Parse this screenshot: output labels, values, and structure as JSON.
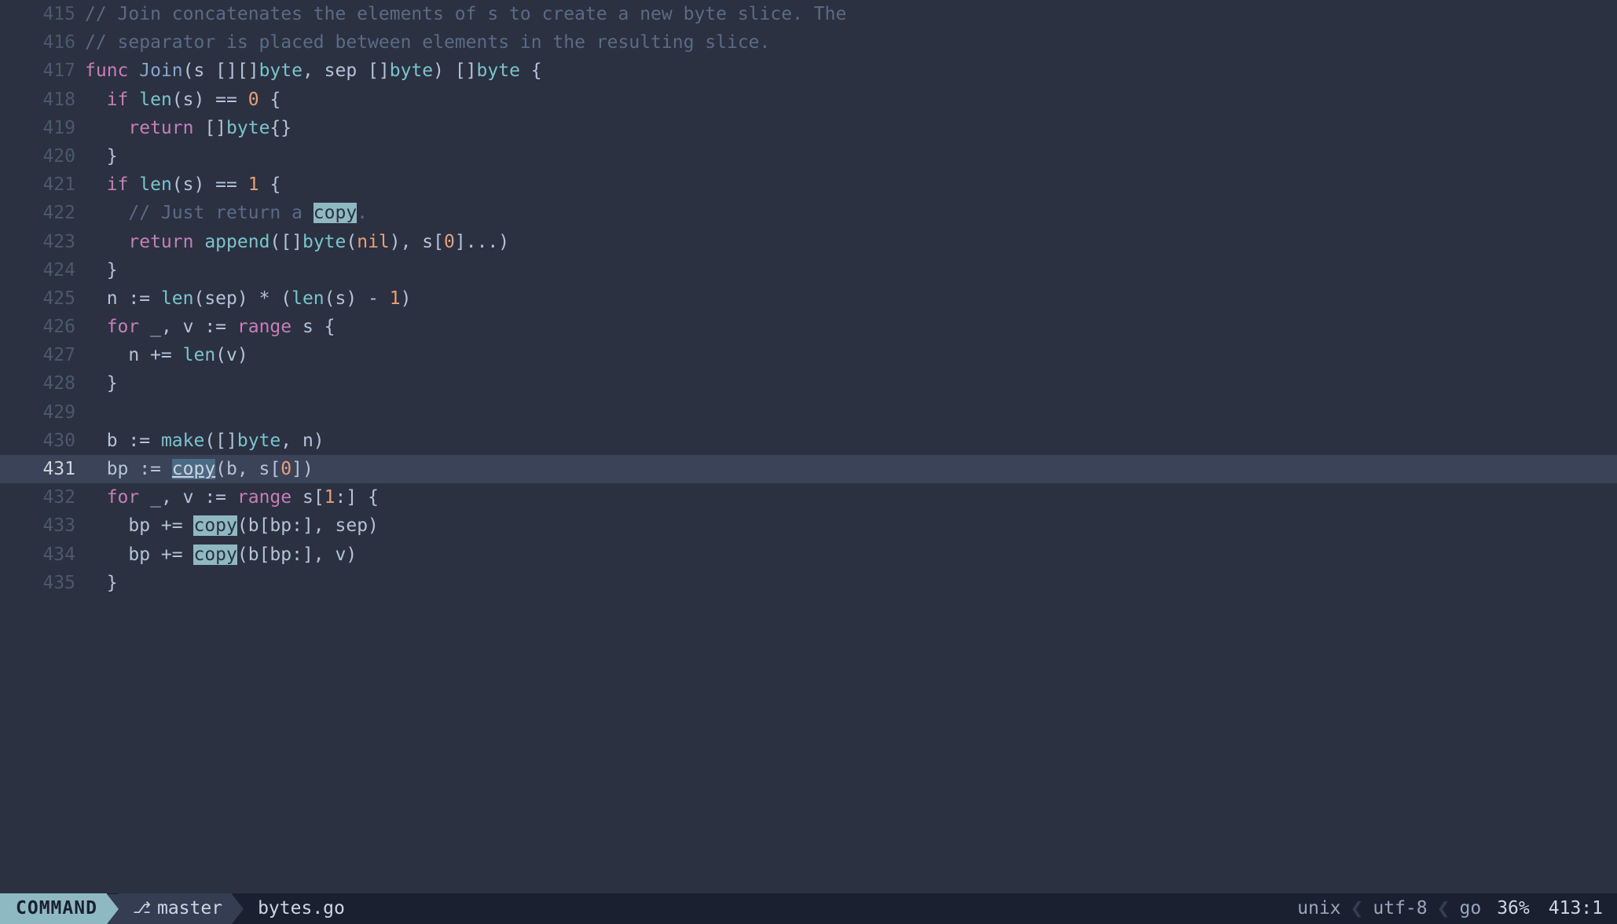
{
  "search_term": "copy",
  "current_line": 431,
  "lines": [
    {
      "n": 415,
      "tokens": [
        {
          "t": "// Join concatenates the elements of s to create a new byte slice. The",
          "c": "cmt"
        }
      ]
    },
    {
      "n": 416,
      "tokens": [
        {
          "t": "// separator is placed between elements in the resulting slice.",
          "c": "cmt"
        }
      ]
    },
    {
      "n": 417,
      "tokens": [
        {
          "t": "func ",
          "c": "kw"
        },
        {
          "t": "Join",
          "c": "fn"
        },
        {
          "t": "(s [][]",
          "c": "pl"
        },
        {
          "t": "byte",
          "c": "typ"
        },
        {
          "t": ", sep []",
          "c": "pl"
        },
        {
          "t": "byte",
          "c": "typ"
        },
        {
          "t": ") []",
          "c": "pl"
        },
        {
          "t": "byte",
          "c": "typ"
        },
        {
          "t": " {",
          "c": "pl"
        }
      ]
    },
    {
      "n": 418,
      "tokens": [
        {
          "t": "  ",
          "c": "pl"
        },
        {
          "t": "if ",
          "c": "kw"
        },
        {
          "t": "len",
          "c": "bi"
        },
        {
          "t": "(s) == ",
          "c": "pl"
        },
        {
          "t": "0",
          "c": "num"
        },
        {
          "t": " {",
          "c": "pl"
        }
      ]
    },
    {
      "n": 419,
      "tokens": [
        {
          "t": "    ",
          "c": "pl"
        },
        {
          "t": "return ",
          "c": "kw"
        },
        {
          "t": "[]",
          "c": "pl"
        },
        {
          "t": "byte",
          "c": "typ"
        },
        {
          "t": "{}",
          "c": "pl"
        }
      ]
    },
    {
      "n": 420,
      "tokens": [
        {
          "t": "  }",
          "c": "pl"
        }
      ]
    },
    {
      "n": 421,
      "tokens": [
        {
          "t": "  ",
          "c": "pl"
        },
        {
          "t": "if ",
          "c": "kw"
        },
        {
          "t": "len",
          "c": "bi"
        },
        {
          "t": "(s) == ",
          "c": "pl"
        },
        {
          "t": "1",
          "c": "num"
        },
        {
          "t": " {",
          "c": "pl"
        }
      ]
    },
    {
      "n": 422,
      "tokens": [
        {
          "t": "    ",
          "c": "pl"
        },
        {
          "t": "// Just return a ",
          "c": "cmt"
        },
        {
          "t": "copy",
          "c": "hl"
        },
        {
          "t": ".",
          "c": "cmt"
        }
      ]
    },
    {
      "n": 423,
      "tokens": [
        {
          "t": "    ",
          "c": "pl"
        },
        {
          "t": "return ",
          "c": "kw"
        },
        {
          "t": "append",
          "c": "bi"
        },
        {
          "t": "([]",
          "c": "pl"
        },
        {
          "t": "byte",
          "c": "typ"
        },
        {
          "t": "(",
          "c": "pl"
        },
        {
          "t": "nil",
          "c": "num"
        },
        {
          "t": "), s[",
          "c": "pl"
        },
        {
          "t": "0",
          "c": "num"
        },
        {
          "t": "]...)",
          "c": "pl"
        }
      ]
    },
    {
      "n": 424,
      "tokens": [
        {
          "t": "  }",
          "c": "pl"
        }
      ]
    },
    {
      "n": 425,
      "tokens": [
        {
          "t": "  n := ",
          "c": "pl"
        },
        {
          "t": "len",
          "c": "bi"
        },
        {
          "t": "(sep) * (",
          "c": "pl"
        },
        {
          "t": "len",
          "c": "bi"
        },
        {
          "t": "(s) - ",
          "c": "pl"
        },
        {
          "t": "1",
          "c": "num"
        },
        {
          "t": ")",
          "c": "pl"
        }
      ]
    },
    {
      "n": 426,
      "tokens": [
        {
          "t": "  ",
          "c": "pl"
        },
        {
          "t": "for ",
          "c": "kw"
        },
        {
          "t": "_, v := ",
          "c": "pl"
        },
        {
          "t": "range ",
          "c": "kw"
        },
        {
          "t": "s {",
          "c": "pl"
        }
      ]
    },
    {
      "n": 427,
      "tokens": [
        {
          "t": "    n += ",
          "c": "pl"
        },
        {
          "t": "len",
          "c": "bi"
        },
        {
          "t": "(v)",
          "c": "pl"
        }
      ]
    },
    {
      "n": 428,
      "tokens": [
        {
          "t": "  }",
          "c": "pl"
        }
      ]
    },
    {
      "n": 429,
      "tokens": []
    },
    {
      "n": 430,
      "tokens": [
        {
          "t": "  b := ",
          "c": "pl"
        },
        {
          "t": "make",
          "c": "bi"
        },
        {
          "t": "([]",
          "c": "pl"
        },
        {
          "t": "byte",
          "c": "typ"
        },
        {
          "t": ", n)",
          "c": "pl"
        }
      ]
    },
    {
      "n": 431,
      "tokens": [
        {
          "t": "  bp := ",
          "c": "pl"
        },
        {
          "t": "copy",
          "c": "hlcur"
        },
        {
          "t": "(b, s[",
          "c": "pl"
        },
        {
          "t": "0",
          "c": "num"
        },
        {
          "t": "])",
          "c": "pl"
        }
      ]
    },
    {
      "n": 432,
      "tokens": [
        {
          "t": "  ",
          "c": "pl"
        },
        {
          "t": "for ",
          "c": "kw"
        },
        {
          "t": "_, v := ",
          "c": "pl"
        },
        {
          "t": "range ",
          "c": "kw"
        },
        {
          "t": "s[",
          "c": "pl"
        },
        {
          "t": "1",
          "c": "num"
        },
        {
          "t": ":] {",
          "c": "pl"
        }
      ]
    },
    {
      "n": 433,
      "tokens": [
        {
          "t": "    bp += ",
          "c": "pl"
        },
        {
          "t": "copy",
          "c": "hl"
        },
        {
          "t": "(b[bp:], sep)",
          "c": "pl"
        }
      ]
    },
    {
      "n": 434,
      "tokens": [
        {
          "t": "    bp += ",
          "c": "pl"
        },
        {
          "t": "copy",
          "c": "hl"
        },
        {
          "t": "(b[bp:], v)",
          "c": "pl"
        }
      ]
    },
    {
      "n": 435,
      "tokens": [
        {
          "t": "  }",
          "c": "pl"
        }
      ]
    }
  ],
  "status": {
    "mode": "COMMAND",
    "branch_icon": "⎇",
    "branch": "master",
    "filename": "bytes.go",
    "fileformat": "unix",
    "encoding": "utf-8",
    "filetype": "go",
    "percent": "36%",
    "position": "413:1"
  },
  "colors": {
    "bg": "#2b3140",
    "status_bg": "#1a2030",
    "mode_bg": "#8fb9c2",
    "branch_bg": "#343d52"
  }
}
